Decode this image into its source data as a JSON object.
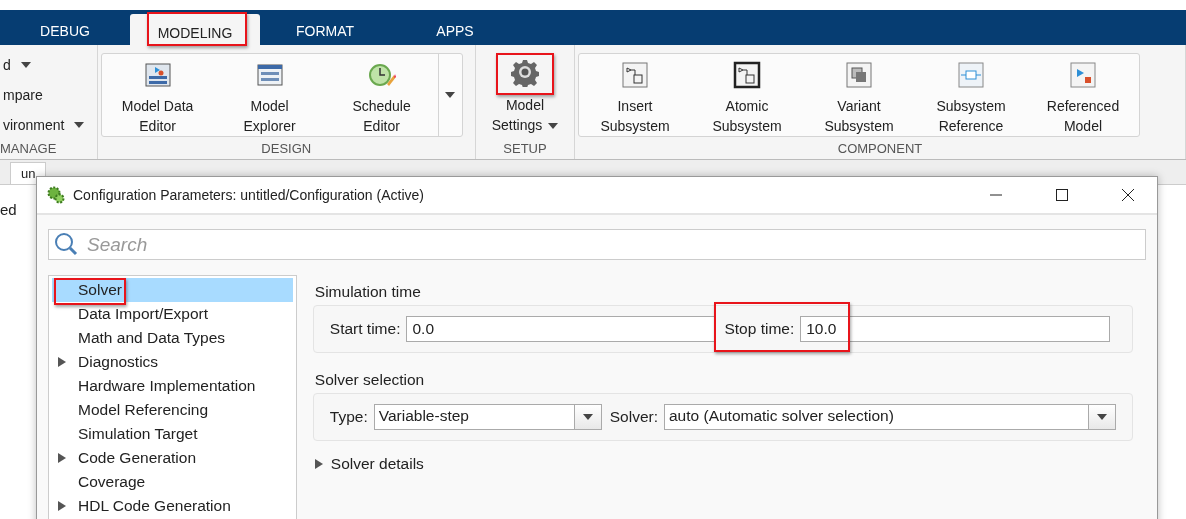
{
  "tabs": [
    {
      "label": "DEBUG",
      "selected": false,
      "annotated": false
    },
    {
      "label": "MODELING",
      "selected": true,
      "annotated": true
    },
    {
      "label": "FORMAT",
      "selected": false,
      "annotated": false
    },
    {
      "label": "APPS",
      "selected": false,
      "annotated": false
    }
  ],
  "ribbon": {
    "groups": [
      {
        "label": "MANAGE",
        "kind": "list",
        "items": [
          {
            "label": "d",
            "menu": true
          },
          {
            "label": "mpare",
            "menu": false
          },
          {
            "label": "vironment",
            "menu": true
          }
        ]
      },
      {
        "label": "DESIGN",
        "kind": "gallery",
        "more": true,
        "items": [
          {
            "kind": "data-editor",
            "lines": [
              "Model Data",
              "Editor"
            ]
          },
          {
            "kind": "explorer",
            "lines": [
              "Model",
              "Explorer"
            ]
          },
          {
            "kind": "schedule",
            "lines": [
              "Schedule",
              "Editor"
            ]
          }
        ]
      },
      {
        "label": "SETUP",
        "kind": "large",
        "items": [
          {
            "kind": "gear",
            "lines": [
              "Model",
              "Settings"
            ],
            "menu": true,
            "annotated": true
          }
        ]
      },
      {
        "label": "COMPONENT",
        "kind": "gallery",
        "more": false,
        "items": [
          {
            "kind": "subsystem",
            "lines": [
              "Insert",
              "Subsystem"
            ]
          },
          {
            "kind": "atomic",
            "lines": [
              "Atomic",
              "Subsystem"
            ]
          },
          {
            "kind": "variant",
            "lines": [
              "Variant",
              "Subsystem"
            ]
          },
          {
            "kind": "reference",
            "lines": [
              "Subsystem",
              "Reference"
            ]
          },
          {
            "kind": "model",
            "lines": [
              "Referenced",
              "Model"
            ]
          }
        ]
      }
    ]
  },
  "doc_tabs": [
    {
      "label": "un"
    }
  ],
  "canvas_text": "ed",
  "dialog": {
    "title": "Configuration Parameters: untitled/Configuration (Active)",
    "search": {
      "placeholder": "Search"
    },
    "tree": [
      {
        "label": "Solver",
        "selected": true,
        "annotated": true,
        "collapsed": false
      },
      {
        "label": "Data Import/Export",
        "selected": false,
        "annotated": false,
        "collapsed": false
      },
      {
        "label": "Math and Data Types",
        "selected": false,
        "annotated": false,
        "collapsed": false
      },
      {
        "label": "Diagnostics",
        "selected": false,
        "annotated": false,
        "collapsed": true
      },
      {
        "label": "Hardware Implementation",
        "selected": false,
        "annotated": false,
        "collapsed": false
      },
      {
        "label": "Model Referencing",
        "selected": false,
        "annotated": false,
        "collapsed": false
      },
      {
        "label": "Simulation Target",
        "selected": false,
        "annotated": false,
        "collapsed": false
      },
      {
        "label": "Code Generation",
        "selected": false,
        "annotated": false,
        "collapsed": true
      },
      {
        "label": "Coverage",
        "selected": false,
        "annotated": false,
        "collapsed": false
      },
      {
        "label": "HDL Code Generation",
        "selected": false,
        "annotated": false,
        "collapsed": true
      }
    ],
    "sections": [
      {
        "title": "Simulation time",
        "fields": [
          {
            "kind": "text",
            "label": "Start time:",
            "value": "0.0",
            "annotated": false
          },
          {
            "kind": "text",
            "label": "Stop time:",
            "value": "10.0",
            "annotated": true
          }
        ]
      },
      {
        "title": "Solver selection",
        "fields": [
          {
            "kind": "dropdown",
            "label": "Type:",
            "value": "Variable-step",
            "annotated": false
          },
          {
            "kind": "dropdown",
            "label": "Solver:",
            "value": "auto (Automatic solver selection)",
            "annotated": false
          }
        ]
      }
    ],
    "details": {
      "label": "Solver details",
      "expanded": false
    }
  }
}
